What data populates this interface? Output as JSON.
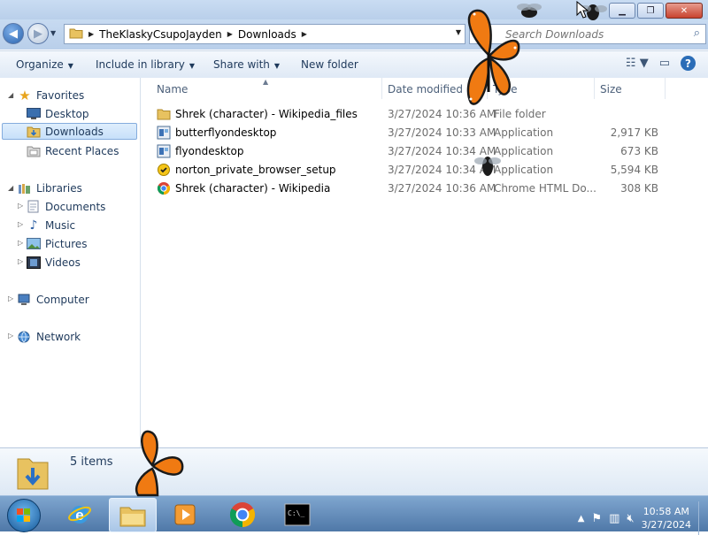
{
  "window": {
    "buttons": {
      "minimize": "▁",
      "maximize": "❐",
      "close": "✕"
    }
  },
  "address": {
    "segments": [
      "TheKlaskyCsupoJayden",
      "Downloads"
    ]
  },
  "search": {
    "placeholder": "Search Downloads"
  },
  "toolbar": {
    "organize": "Organize",
    "include_in_library": "Include in library",
    "share_with": "Share with",
    "new_folder": "New folder"
  },
  "nav": {
    "favorites": "Favorites",
    "desktop": "Desktop",
    "downloads": "Downloads",
    "recent_places": "Recent Places",
    "libraries": "Libraries",
    "documents": "Documents",
    "music": "Music",
    "pictures": "Pictures",
    "videos": "Videos",
    "computer": "Computer",
    "network": "Network"
  },
  "columns": {
    "name": "Name",
    "date_modified": "Date modified",
    "type": "Type",
    "size": "Size"
  },
  "files": [
    {
      "name": "Shrek (character) - Wikipedia_files",
      "date": "3/27/2024 10:36 AM",
      "type": "File folder",
      "size": "",
      "icon": "folder-icon"
    },
    {
      "name": "butterflyondesktop",
      "date": "3/27/2024 10:33 AM",
      "type": "Application",
      "size": "2,917 KB",
      "icon": "installer-icon"
    },
    {
      "name": "flyondesktop",
      "date": "3/27/2024 10:34 AM",
      "type": "Application",
      "size": "673 KB",
      "icon": "installer-icon"
    },
    {
      "name": "norton_private_browser_setup",
      "date": "3/27/2024 10:34 AM",
      "type": "Application",
      "size": "5,594 KB",
      "icon": "norton-icon"
    },
    {
      "name": "Shrek (character) - Wikipedia",
      "date": "3/27/2024 10:36 AM",
      "type": "Chrome HTML Do...",
      "size": "308 KB",
      "icon": "chrome-icon"
    }
  ],
  "status": {
    "count": "5 items"
  },
  "taskbar": {
    "apps": [
      "internet-explorer",
      "windows-explorer",
      "media-player",
      "chrome",
      "command-prompt"
    ],
    "time": "10:58 AM",
    "date": "3/27/2024"
  },
  "colors": {
    "accent": "#2b6db7",
    "selection": "#cde6fb",
    "butterfly": "#f07a12"
  }
}
